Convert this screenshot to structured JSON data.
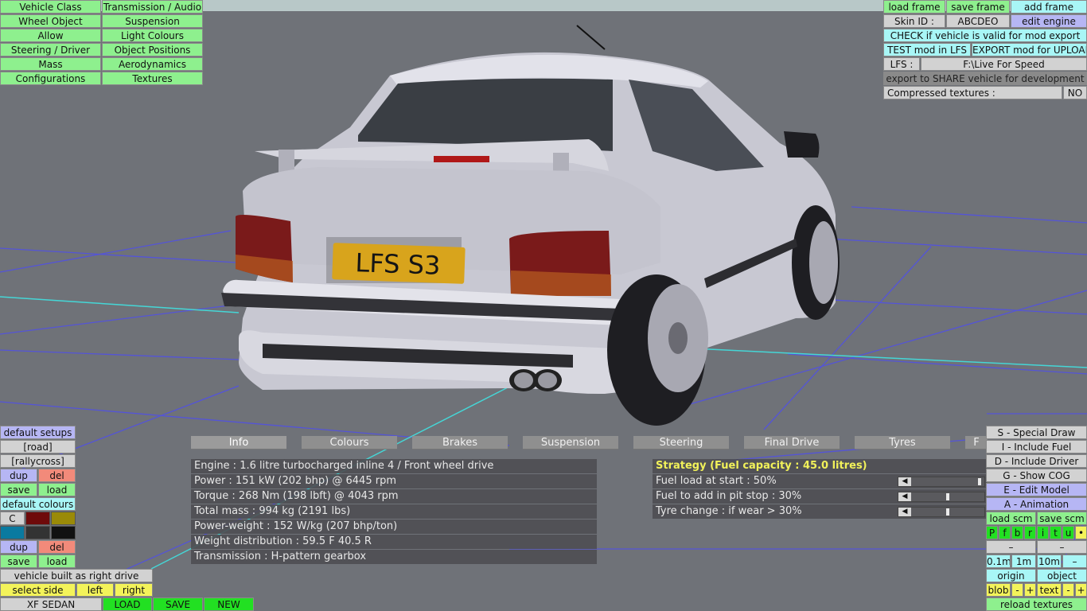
{
  "top_left_menu": [
    {
      "label": "Vehicle Class"
    },
    {
      "label": "Transmission / Audio"
    },
    {
      "label": "Wheel Object"
    },
    {
      "label": "Suspension"
    },
    {
      "label": "Allow"
    },
    {
      "label": "Light Colours"
    },
    {
      "label": "Steering / Driver"
    },
    {
      "label": "Object Positions"
    },
    {
      "label": "Mass"
    },
    {
      "label": "Aerodynamics"
    },
    {
      "label": "Configurations"
    },
    {
      "label": "Textures"
    }
  ],
  "top_right": {
    "load_frame": "load frame",
    "save_frame": "save frame",
    "add_frame": "add frame",
    "skin_id_label": "Skin ID :",
    "skin_id_value": "ABCDEO",
    "edit_engine": "edit engine",
    "check_valid": "CHECK if vehicle is valid for mod export",
    "test_mod": "TEST mod in LFS",
    "export_mod": "EXPORT mod for UPLOAD",
    "lfs_label": "LFS :",
    "lfs_path": "F:\\Live For Speed",
    "export_share": "export to SHARE vehicle for development",
    "compressed_label": "Compressed textures :",
    "compressed_value": "NO"
  },
  "plate_text": "LFS S3",
  "tabs": [
    {
      "label": "Info"
    },
    {
      "label": "Colours"
    },
    {
      "label": "Brakes"
    },
    {
      "label": "Suspension"
    },
    {
      "label": "Steering"
    },
    {
      "label": "Final Drive"
    },
    {
      "label": "Tyres"
    },
    {
      "label": "F"
    }
  ],
  "info_lines": [
    "Engine : 1.6 litre turbocharged inline 4 / Front wheel drive",
    "Power : 151 kW (202 bhp) @ 6445 rpm",
    "Torque : 268 Nm (198 lbft) @ 4043 rpm",
    "Total mass : 994 kg (2191 lbs)",
    "Power-weight : 152 W/kg (207 bhp/ton)",
    "Weight distribution : 59.5 F  40.5 R",
    "Transmission : H-pattern gearbox"
  ],
  "strategy": {
    "title": "Strategy (Fuel capacity : 45.0 litres)",
    "rows": [
      {
        "label": "Fuel load at start : 50%",
        "level": 0.98
      },
      {
        "label": "Fuel to add in pit stop : 30%",
        "level": 0.5
      },
      {
        "label": "Tyre change : if wear > 30%",
        "level": 0.5
      }
    ]
  },
  "bottom_left": {
    "default_setups": "default setups",
    "road": "[road]",
    "rallycross": "[rallycross]",
    "dup": "dup",
    "del": "del",
    "save": "save",
    "load": "load",
    "default_colours": "default colours",
    "c_label": "C",
    "built_as": "vehicle built as right drive",
    "select_side": "select side",
    "left": "left",
    "right": "right",
    "vehicle_name": "XF SEDAN",
    "load_btn": "LOAD",
    "save_btn": "SAVE",
    "new_btn": "NEW",
    "colors": {
      "row1": [
        "#d8d8d8",
        "#6e0a0a",
        "#9a8a08"
      ],
      "row2": [
        "#0a7aa0",
        "#333333",
        "#111111"
      ]
    }
  },
  "bottom_right": {
    "special_draw": "S - Special Draw",
    "include_fuel": "I - Include Fuel",
    "include_driver": "D - Include Driver",
    "show_cog": "G - Show COG",
    "edit_model": "E - Edit Model",
    "animation": "A - Animation",
    "load_scm": "load scm",
    "save_scm": "save scm",
    "letters": [
      "P",
      "f",
      "b",
      "r",
      "i",
      "t",
      "u",
      "•"
    ],
    "dash1": "–",
    "dash2": "–",
    "step1": "0.1m",
    "step2": "1m",
    "step3": "10m",
    "step_minus": "–",
    "origin": "origin",
    "object": "object",
    "blob": "blob",
    "text": "text",
    "minus": "-",
    "plus": "+",
    "reload": "reload textures"
  }
}
